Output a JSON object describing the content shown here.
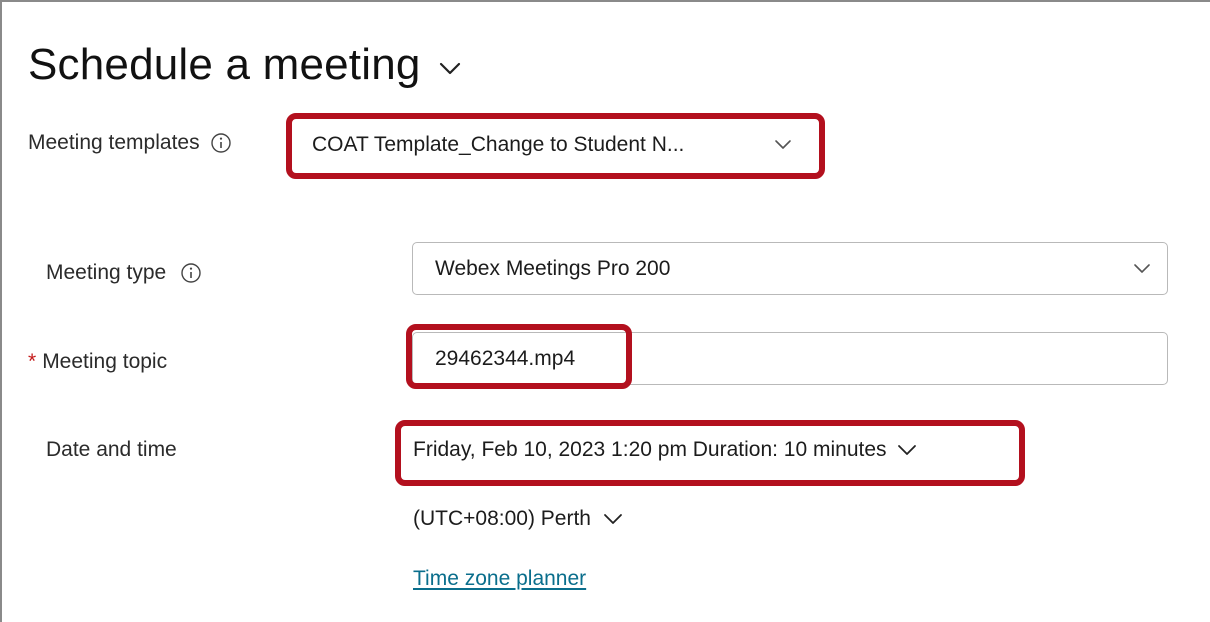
{
  "page": {
    "title": "Schedule a meeting"
  },
  "meeting_templates": {
    "label": "Meeting templates",
    "value": "COAT Template_Change to Student N..."
  },
  "meeting_type": {
    "label": "Meeting type",
    "value": "Webex Meetings Pro 200"
  },
  "meeting_topic": {
    "required_marker": "*",
    "label": "Meeting topic",
    "value": "29462344.mp4"
  },
  "date_time": {
    "label": "Date and time",
    "value": "Friday, Feb 10, 2023 1:20 pm Duration: 10 minutes"
  },
  "timezone": {
    "value": "(UTC+08:00) Perth"
  },
  "planner": {
    "link_label": "Time zone planner"
  },
  "colors": {
    "highlight": "#b3101e",
    "link": "#0a6e8c",
    "required": "#c41a1a"
  },
  "icons": [
    "chevron-down-icon",
    "info-icon"
  ]
}
